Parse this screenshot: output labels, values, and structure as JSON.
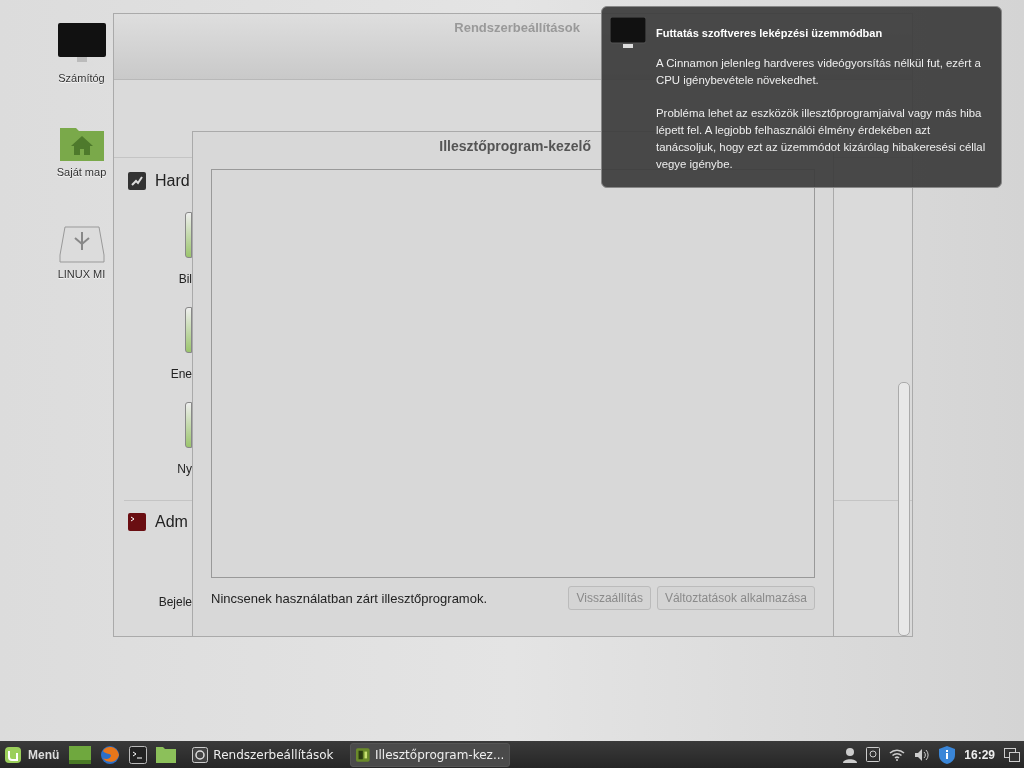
{
  "desktop_icons": [
    {
      "label": "Számítóg",
      "kind": "computer"
    },
    {
      "label": "Saját map",
      "kind": "home"
    },
    {
      "label": "LINUX MI",
      "kind": "usb"
    }
  ],
  "settings_window": {
    "title": "Rendszerbeállítások",
    "sections": [
      {
        "title": "Hard",
        "kind": "hardware",
        "items": [
          "Bil",
          "Ene",
          "Ny"
        ]
      },
      {
        "title": "Adm",
        "kind": "admin",
        "items": [
          "Bejele"
        ]
      }
    ]
  },
  "driver_window": {
    "title": "Illesztőprogram-kezelő",
    "status": "Nincsenek használatban zárt illesztőprogramok.",
    "buttons": [
      {
        "label": "Visszaállítás",
        "disabled": true
      },
      {
        "label": "Változtatások alkalmazása",
        "disabled": true
      }
    ]
  },
  "notification": {
    "title": "Futtatás szoftveres leképzési üzemmódban",
    "paragraphs": [
      "A Cinnamon jelenleg hardveres videógyorsítás nélkül fut, ezért a CPU igénybevétele növekedhet.",
      "Probléma lehet az eszközök illesztőprogramjaival vagy más hiba lépett fel. A legjobb felhasználói élmény érdekében azt tanácsoljuk, hogy ezt az üzemmódot kizárólag hibakeresési céllal vegye igénybe."
    ]
  },
  "taskbar": {
    "menu_label": "Menü",
    "launchers": [
      {
        "kind": "desktop"
      },
      {
        "kind": "browser"
      },
      {
        "kind": "terminal"
      },
      {
        "kind": "folder"
      }
    ],
    "windows": [
      {
        "label": "Rendszerbeállítások",
        "kind": "settings",
        "selected": false
      },
      {
        "label": "Illesztőprogram-kez...",
        "kind": "driver",
        "selected": true
      }
    ],
    "clock": "16:29"
  }
}
